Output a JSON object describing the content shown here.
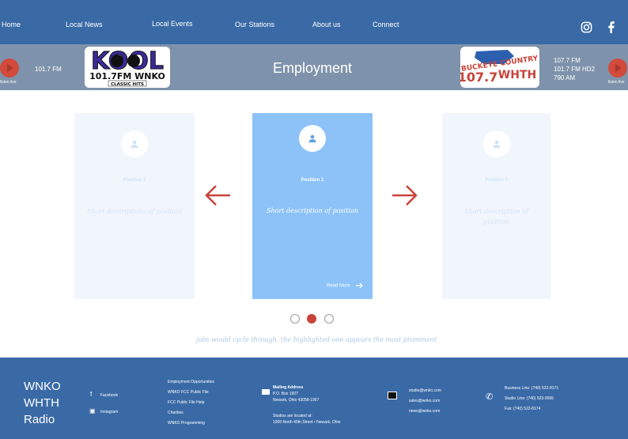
{
  "nav": {
    "items": [
      "Home",
      "Local News",
      "Local Events",
      "Our Stations",
      "About us",
      "Connect"
    ],
    "social": [
      "instagram-icon",
      "facebook-icon"
    ]
  },
  "band": {
    "left_freq": "101.7 FM",
    "listen_left": "listen live",
    "listen_right": "listen live",
    "title": "Employment",
    "logo_left": {
      "name": "KOOL",
      "line2": "101.7FM WNKO",
      "line3": "CLASSIC HITS"
    },
    "logo_right": {
      "line1": "BUCKEYE COUNTRY",
      "line2": "107.7",
      "line3": "WHTH"
    },
    "right_freqs": [
      "107.7 FM",
      "101.7 FM HD2",
      "790 AM"
    ]
  },
  "cards": [
    {
      "title": "Position 2",
      "desc": "Short descriptions of position"
    },
    {
      "title": "Position 1",
      "desc": "Short description of position",
      "link": "Read More"
    },
    {
      "title": "Position 3",
      "desc": "Short description of position"
    }
  ],
  "caption": "jobs would cycle through, the highlighted one appears the most prominent",
  "carousel": {
    "active_index": 1,
    "count": 3
  },
  "colors": {
    "nav": "#3a6aa6",
    "band": "#7e93ab",
    "accent": "#c8433a",
    "card_active": "#8cc2f7"
  },
  "footer": {
    "brand": [
      "WNKO",
      "WHTH",
      "Radio"
    ],
    "social_links": [
      "Facebook",
      "Instagram"
    ],
    "links": [
      "Employment Opportunities",
      "WNKO FCC Public File",
      "FCC Public File Help",
      "Charities",
      "WNKO Programming"
    ],
    "mailing": [
      "Mailing Address",
      "P.O. Box 1907",
      "Newark, Ohio 43058-1907"
    ],
    "studios": [
      "Studios are located at:",
      "1000 North 40th Street • Newark, Ohio"
    ],
    "emails": [
      "studio@wnko.com",
      "sales@wnko.com",
      "news@wnko.com"
    ],
    "phones": [
      "Business Line: (740) 522-8171",
      "Studio Line: (740) 523-0095",
      "Fax: (740) 522-8174"
    ]
  }
}
